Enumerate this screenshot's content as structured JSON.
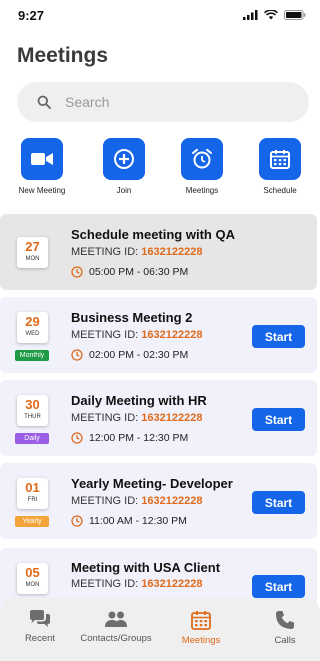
{
  "status": {
    "time": "9:27"
  },
  "header": {
    "title": "Meetings"
  },
  "search": {
    "placeholder": "Search"
  },
  "quick_actions": [
    {
      "label": "New Meeting",
      "icon": "video-camera-icon"
    },
    {
      "label": "Join",
      "icon": "plus-circle-icon"
    },
    {
      "label": "Meetings",
      "icon": "alarm-clock-icon"
    },
    {
      "label": "Schedule",
      "icon": "calendar-icon"
    }
  ],
  "meetings": [
    {
      "day": "27",
      "dow": "MON",
      "title": "Schedule meeting with QA",
      "id_label": "MEETING ID:",
      "id": "1632122228",
      "time": "05:00 PM - 06:30 PM",
      "frequency": "",
      "selected": true,
      "action": ""
    },
    {
      "day": "29",
      "dow": "WED",
      "title": "Business Meeting 2",
      "id_label": "MEETING ID:",
      "id": "1632122228",
      "time": "02:00 PM - 02:30 PM",
      "frequency": "Monthly",
      "selected": false,
      "action": "Start"
    },
    {
      "day": "30",
      "dow": "THUR",
      "title": "Daily Meeting with HR",
      "id_label": "MEETING ID:",
      "id": "1632122228",
      "time": "12:00 PM - 12:30 PM",
      "frequency": "Daily",
      "selected": false,
      "action": "Start"
    },
    {
      "day": "01",
      "dow": "FRI",
      "title": "Yearly Meeting- Developer",
      "id_label": "MEETING ID:",
      "id": "1632122228",
      "time": "11:00 AM - 12:30 PM",
      "frequency": "Yearly",
      "selected": false,
      "action": "Start"
    },
    {
      "day": "05",
      "dow": "MON",
      "title": "Meeting with USA Client",
      "id_label": "MEETING ID:",
      "id": "1632122228",
      "time": "",
      "frequency": "",
      "selected": false,
      "action": "Start"
    }
  ],
  "tabs": [
    {
      "label": "Recent",
      "icon": "chat-bubbles-icon",
      "active": false
    },
    {
      "label": "Contacts/Groups",
      "icon": "group-icon",
      "active": false
    },
    {
      "label": "Meetings",
      "icon": "calendar-icon",
      "active": true
    },
    {
      "label": "Calls",
      "icon": "phone-icon",
      "active": false
    }
  ],
  "colors": {
    "primary": "#1565e8",
    "accent": "#e06a1b",
    "monthly": "#1e9a45",
    "daily": "#9b5de5",
    "yearly": "#f2a33a",
    "card": "#f1f1fb",
    "card_selected": "#e6e6e6"
  }
}
